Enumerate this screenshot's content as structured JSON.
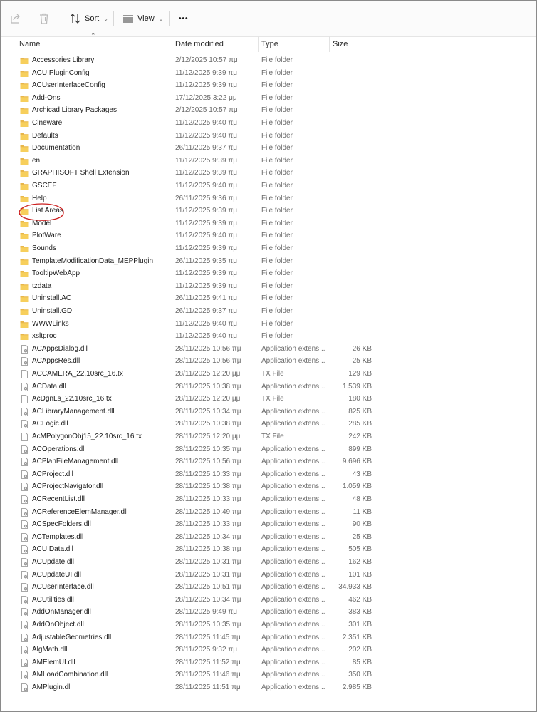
{
  "toolbar": {
    "share_icon": "share-icon",
    "delete_icon": "trash-icon",
    "sort_label": "Sort",
    "view_label": "View",
    "more_label": "•••"
  },
  "columns": {
    "name": "Name",
    "date": "Date modified",
    "type": "Type",
    "size": "Size"
  },
  "annotation_color": "#cc1f1f",
  "rows": [
    {
      "kind": "folder",
      "name": "Accessories Library",
      "date": "2/12/2025 10:57 πμ",
      "type": "File folder",
      "size": ""
    },
    {
      "kind": "folder",
      "name": "ACUIPluginConfig",
      "date": "11/12/2025 9:39 πμ",
      "type": "File folder",
      "size": ""
    },
    {
      "kind": "folder",
      "name": "ACUserInterfaceConfig",
      "date": "11/12/2025 9:39 πμ",
      "type": "File folder",
      "size": ""
    },
    {
      "kind": "folder",
      "name": "Add-Ons",
      "date": "17/12/2025 3:22 μμ",
      "type": "File folder",
      "size": ""
    },
    {
      "kind": "folder",
      "name": "Archicad Library Packages",
      "date": "2/12/2025 10:57 πμ",
      "type": "File folder",
      "size": ""
    },
    {
      "kind": "folder",
      "name": "Cineware",
      "date": "11/12/2025 9:40 πμ",
      "type": "File folder",
      "size": ""
    },
    {
      "kind": "folder",
      "name": "Defaults",
      "date": "11/12/2025 9:40 πμ",
      "type": "File folder",
      "size": ""
    },
    {
      "kind": "folder",
      "name": "Documentation",
      "date": "26/11/2025 9:37 πμ",
      "type": "File folder",
      "size": ""
    },
    {
      "kind": "folder",
      "name": "en",
      "date": "11/12/2025 9:39 πμ",
      "type": "File folder",
      "size": ""
    },
    {
      "kind": "folder",
      "name": "GRAPHISOFT Shell Extension",
      "date": "11/12/2025 9:39 πμ",
      "type": "File folder",
      "size": ""
    },
    {
      "kind": "folder",
      "name": "GSCEF",
      "date": "11/12/2025 9:40 πμ",
      "type": "File folder",
      "size": ""
    },
    {
      "kind": "folder",
      "name": "Help",
      "date": "26/11/2025 9:36 πμ",
      "type": "File folder",
      "size": ""
    },
    {
      "kind": "folder",
      "name": "List Areas",
      "date": "11/12/2025 9:39 πμ",
      "type": "File folder",
      "size": ""
    },
    {
      "kind": "folder",
      "name": "Model",
      "date": "11/12/2025 9:39 πμ",
      "type": "File folder",
      "size": ""
    },
    {
      "kind": "folder",
      "name": "PlotWare",
      "date": "11/12/2025 9:40 πμ",
      "type": "File folder",
      "size": ""
    },
    {
      "kind": "folder",
      "name": "Sounds",
      "date": "11/12/2025 9:39 πμ",
      "type": "File folder",
      "size": ""
    },
    {
      "kind": "folder",
      "name": "TemplateModificationData_MEPPlugin",
      "date": "26/11/2025 9:35 πμ",
      "type": "File folder",
      "size": ""
    },
    {
      "kind": "folder",
      "name": "TooltipWebApp",
      "date": "11/12/2025 9:39 πμ",
      "type": "File folder",
      "size": ""
    },
    {
      "kind": "folder",
      "name": "tzdata",
      "date": "11/12/2025 9:39 πμ",
      "type": "File folder",
      "size": ""
    },
    {
      "kind": "folder",
      "name": "Uninstall.AC",
      "date": "26/11/2025 9:41 πμ",
      "type": "File folder",
      "size": ""
    },
    {
      "kind": "folder",
      "name": "Uninstall.GD",
      "date": "26/11/2025 9:37 πμ",
      "type": "File folder",
      "size": ""
    },
    {
      "kind": "folder",
      "name": "WWWLinks",
      "date": "11/12/2025 9:40 πμ",
      "type": "File folder",
      "size": ""
    },
    {
      "kind": "folder",
      "name": "xsltproc",
      "date": "11/12/2025 9:40 πμ",
      "type": "File folder",
      "size": ""
    },
    {
      "kind": "dll",
      "name": "ACAppsDialog.dll",
      "date": "28/11/2025 10:56 πμ",
      "type": "Application extens...",
      "size": "26 KB"
    },
    {
      "kind": "dll",
      "name": "ACAppsRes.dll",
      "date": "28/11/2025 10:56 πμ",
      "type": "Application extens...",
      "size": "25 KB"
    },
    {
      "kind": "txt",
      "name": "ACCAMERA_22.10src_16.tx",
      "date": "28/11/2025 12:20 μμ",
      "type": "TX File",
      "size": "129 KB"
    },
    {
      "kind": "dll",
      "name": "ACData.dll",
      "date": "28/11/2025 10:38 πμ",
      "type": "Application extens...",
      "size": "1.539 KB"
    },
    {
      "kind": "txt",
      "name": "AcDgnLs_22.10src_16.tx",
      "date": "28/11/2025 12:20 μμ",
      "type": "TX File",
      "size": "180 KB"
    },
    {
      "kind": "dll",
      "name": "ACLibraryManagement.dll",
      "date": "28/11/2025 10:34 πμ",
      "type": "Application extens...",
      "size": "825 KB"
    },
    {
      "kind": "dll",
      "name": "ACLogic.dll",
      "date": "28/11/2025 10:38 πμ",
      "type": "Application extens...",
      "size": "285 KB"
    },
    {
      "kind": "txt",
      "name": "AcMPolygonObj15_22.10src_16.tx",
      "date": "28/11/2025 12:20 μμ",
      "type": "TX File",
      "size": "242 KB"
    },
    {
      "kind": "dll",
      "name": "ACOperations.dll",
      "date": "28/11/2025 10:35 πμ",
      "type": "Application extens...",
      "size": "899 KB"
    },
    {
      "kind": "dll",
      "name": "ACPlanFileManagement.dll",
      "date": "28/11/2025 10:56 πμ",
      "type": "Application extens...",
      "size": "9.696 KB"
    },
    {
      "kind": "dll",
      "name": "ACProject.dll",
      "date": "28/11/2025 10:33 πμ",
      "type": "Application extens...",
      "size": "43 KB"
    },
    {
      "kind": "dll",
      "name": "ACProjectNavigator.dll",
      "date": "28/11/2025 10:38 πμ",
      "type": "Application extens...",
      "size": "1.059 KB"
    },
    {
      "kind": "dll",
      "name": "ACRecentList.dll",
      "date": "28/11/2025 10:33 πμ",
      "type": "Application extens...",
      "size": "48 KB"
    },
    {
      "kind": "dll",
      "name": "ACReferenceElemManager.dll",
      "date": "28/11/2025 10:49 πμ",
      "type": "Application extens...",
      "size": "11 KB"
    },
    {
      "kind": "dll",
      "name": "ACSpecFolders.dll",
      "date": "28/11/2025 10:33 πμ",
      "type": "Application extens...",
      "size": "90 KB"
    },
    {
      "kind": "dll",
      "name": "ACTemplates.dll",
      "date": "28/11/2025 10:34 πμ",
      "type": "Application extens...",
      "size": "25 KB"
    },
    {
      "kind": "dll",
      "name": "ACUIData.dll",
      "date": "28/11/2025 10:38 πμ",
      "type": "Application extens...",
      "size": "505 KB"
    },
    {
      "kind": "dll",
      "name": "ACUpdate.dll",
      "date": "28/11/2025 10:31 πμ",
      "type": "Application extens...",
      "size": "162 KB"
    },
    {
      "kind": "dll",
      "name": "ACUpdateUI.dll",
      "date": "28/11/2025 10:31 πμ",
      "type": "Application extens...",
      "size": "101 KB"
    },
    {
      "kind": "dll",
      "name": "ACUserInterface.dll",
      "date": "28/11/2025 10:51 πμ",
      "type": "Application extens...",
      "size": "34.933 KB"
    },
    {
      "kind": "dll",
      "name": "ACUtilities.dll",
      "date": "28/11/2025 10:34 πμ",
      "type": "Application extens...",
      "size": "462 KB"
    },
    {
      "kind": "dll",
      "name": "AddOnManager.dll",
      "date": "28/11/2025 9:49 πμ",
      "type": "Application extens...",
      "size": "383 KB"
    },
    {
      "kind": "dll",
      "name": "AddOnObject.dll",
      "date": "28/11/2025 10:35 πμ",
      "type": "Application extens...",
      "size": "301 KB"
    },
    {
      "kind": "dll",
      "name": "AdjustableGeometries.dll",
      "date": "28/11/2025 11:45 πμ",
      "type": "Application extens...",
      "size": "2.351 KB"
    },
    {
      "kind": "dll",
      "name": "AlgMath.dll",
      "date": "28/11/2025 9:32 πμ",
      "type": "Application extens...",
      "size": "202 KB"
    },
    {
      "kind": "dll",
      "name": "AMElemUI.dll",
      "date": "28/11/2025 11:52 πμ",
      "type": "Application extens...",
      "size": "85 KB"
    },
    {
      "kind": "dll",
      "name": "AMLoadCombination.dll",
      "date": "28/11/2025 11:46 πμ",
      "type": "Application extens...",
      "size": "350 KB"
    },
    {
      "kind": "dll",
      "name": "AMPlugin.dll",
      "date": "28/11/2025 11:51 πμ",
      "type": "Application extens...",
      "size": "2.985 KB"
    }
  ]
}
